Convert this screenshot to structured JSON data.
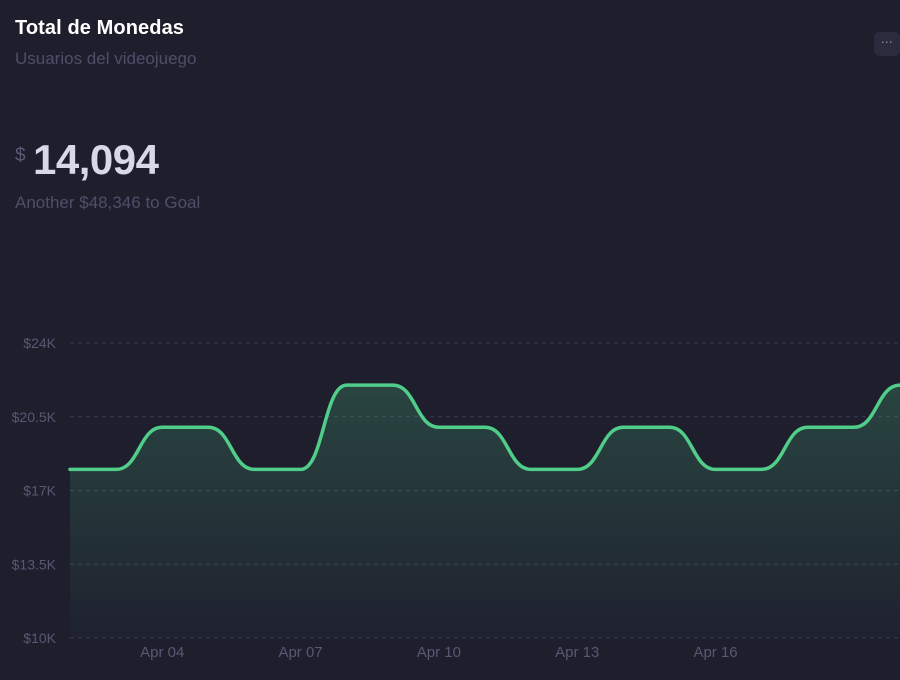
{
  "header": {
    "title": "Total de Monedas",
    "subtitle": "Usuarios del videojuego",
    "menu_icon": "⋯"
  },
  "stat": {
    "currency": "$",
    "value": "14,094",
    "goal_text": "Another $48,346 to Goal"
  },
  "colors": {
    "background": "#1e1e2d",
    "line": "#50cd89",
    "grid": "#3a3a4f"
  },
  "chart_data": {
    "type": "area",
    "title": "",
    "xlabel": "",
    "ylabel": "",
    "ylim": [
      10000,
      24000
    ],
    "yticks": [
      "$10K",
      "$13.5K",
      "$17K",
      "$20.5K",
      "$24K"
    ],
    "ytick_values": [
      10000,
      13500,
      17000,
      20500,
      24000
    ],
    "xticks": [
      "Apr 04",
      "Apr 07",
      "Apr 10",
      "Apr 13",
      "Apr 16"
    ],
    "grid": true,
    "series": [
      {
        "values": [
          18000,
          18000,
          20000,
          20000,
          18000,
          18000,
          22000,
          22000,
          20000,
          20000,
          18000,
          18000,
          20000,
          20000,
          18000,
          18000,
          20000,
          20000,
          22000
        ]
      }
    ]
  }
}
